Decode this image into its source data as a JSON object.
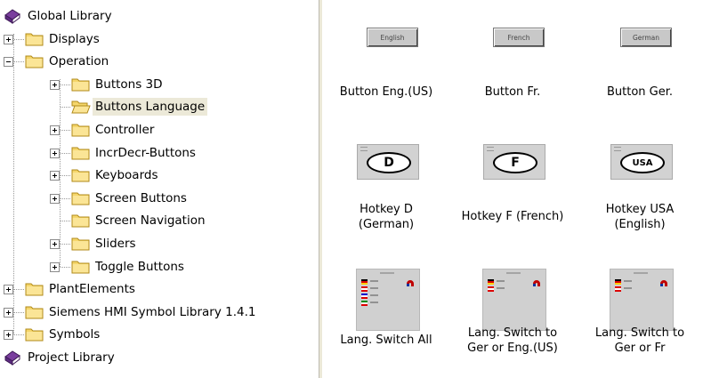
{
  "tree": {
    "items": [
      {
        "label": "Global Library",
        "kind": "book",
        "level": 0,
        "expander": "none"
      },
      {
        "label": "Displays",
        "kind": "folder",
        "level": 1,
        "expander": "plus"
      },
      {
        "label": "Operation",
        "kind": "folder",
        "level": 1,
        "expander": "minus"
      },
      {
        "label": "Buttons 3D",
        "kind": "folder",
        "level": 2,
        "expander": "plus"
      },
      {
        "label": "Buttons Language",
        "kind": "folder-open",
        "level": 2,
        "expander": "none",
        "selected": true
      },
      {
        "label": "Controller",
        "kind": "folder",
        "level": 2,
        "expander": "plus"
      },
      {
        "label": "IncrDecr-Buttons",
        "kind": "folder",
        "level": 2,
        "expander": "plus"
      },
      {
        "label": "Keyboards",
        "kind": "folder",
        "level": 2,
        "expander": "plus"
      },
      {
        "label": "Screen Buttons",
        "kind": "folder",
        "level": 2,
        "expander": "plus"
      },
      {
        "label": "Screen Navigation",
        "kind": "folder",
        "level": 2,
        "expander": "none"
      },
      {
        "label": "Sliders",
        "kind": "folder",
        "level": 2,
        "expander": "plus"
      },
      {
        "label": "Toggle Buttons",
        "kind": "folder",
        "level": 2,
        "expander": "plus"
      },
      {
        "label": "PlantElements",
        "kind": "folder",
        "level": 1,
        "expander": "plus"
      },
      {
        "label": "Siemens HMI Symbol Library 1.4.1",
        "kind": "folder",
        "level": 1,
        "expander": "plus"
      },
      {
        "label": "Symbols",
        "kind": "folder",
        "level": 1,
        "expander": "plus"
      },
      {
        "label": "Project Library",
        "kind": "book",
        "level": 0,
        "expander": "none"
      }
    ]
  },
  "grid": {
    "items": [
      {
        "caption": "Button Eng.(US)",
        "thumb": "button",
        "thumb_text": "English"
      },
      {
        "caption": "Button Fr.",
        "thumb": "button",
        "thumb_text": "French"
      },
      {
        "caption": "Button Ger.",
        "thumb": "button",
        "thumb_text": "German"
      },
      {
        "caption": "Hotkey D\n(German)",
        "thumb": "hotkey",
        "thumb_text": "D"
      },
      {
        "caption": "Hotkey F (French)",
        "thumb": "hotkey",
        "thumb_text": "F"
      },
      {
        "caption": "Hotkey USA\n(English)",
        "thumb": "hotkey",
        "thumb_text": "USA"
      },
      {
        "caption": "Lang. Switch All",
        "thumb": "langswitch",
        "flags": 4
      },
      {
        "caption": "Lang. Switch to\nGer or Eng.(US)",
        "thumb": "langswitch",
        "flags": 2
      },
      {
        "caption": "Lang. Switch to\nGer or Fr",
        "thumb": "langswitch",
        "flags": 2
      }
    ]
  },
  "colors": {
    "folder": "#f5d66b",
    "folder_edge": "#b08a1a",
    "book": "#7a3e9e",
    "selection": "#ece9d8"
  }
}
